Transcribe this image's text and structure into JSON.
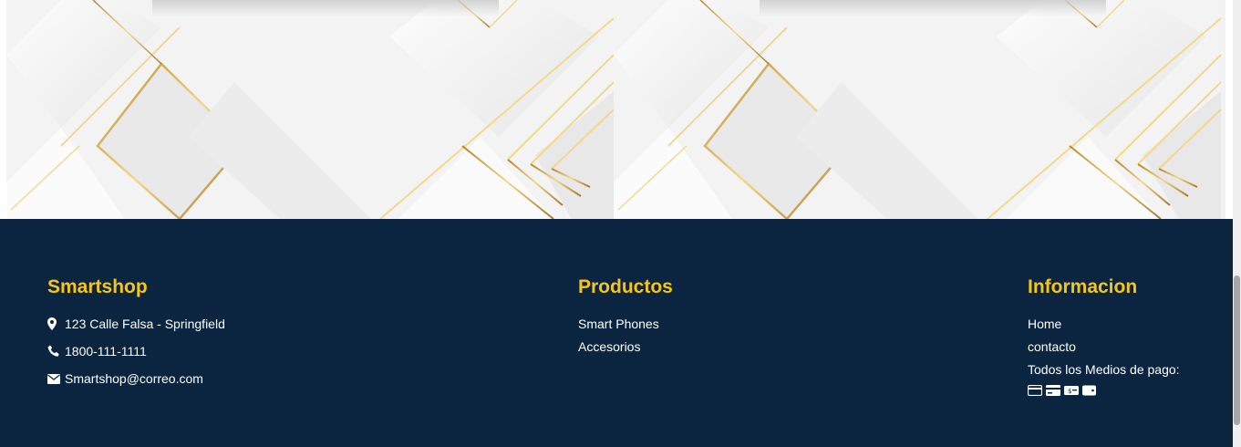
{
  "colors": {
    "footer_bg": "#0b2541",
    "heading": "#f5c518",
    "text": "#ffffff",
    "gold_lines": "#c9a14a"
  },
  "banner": {
    "pattern": "white-geometric-gold-lines"
  },
  "footer": {
    "brand": {
      "title": "Smartshop",
      "address": "123 Calle Falsa - Springfield",
      "phone": "1800-111-1111",
      "email": "Smartshop@correo.com",
      "icons": [
        "map-marker-icon",
        "phone-icon",
        "envelope-icon"
      ]
    },
    "products": {
      "title": "Productos",
      "links": [
        "Smart Phones",
        "Accesorios"
      ]
    },
    "info": {
      "title": "Informacion",
      "links": [
        "Home",
        "contacto"
      ],
      "payment_label": "Todos los Medios de pago:",
      "payment_icons": [
        "credit-card-icon",
        "debit-card-icon",
        "cash-icon",
        "wallet-icon"
      ]
    }
  }
}
